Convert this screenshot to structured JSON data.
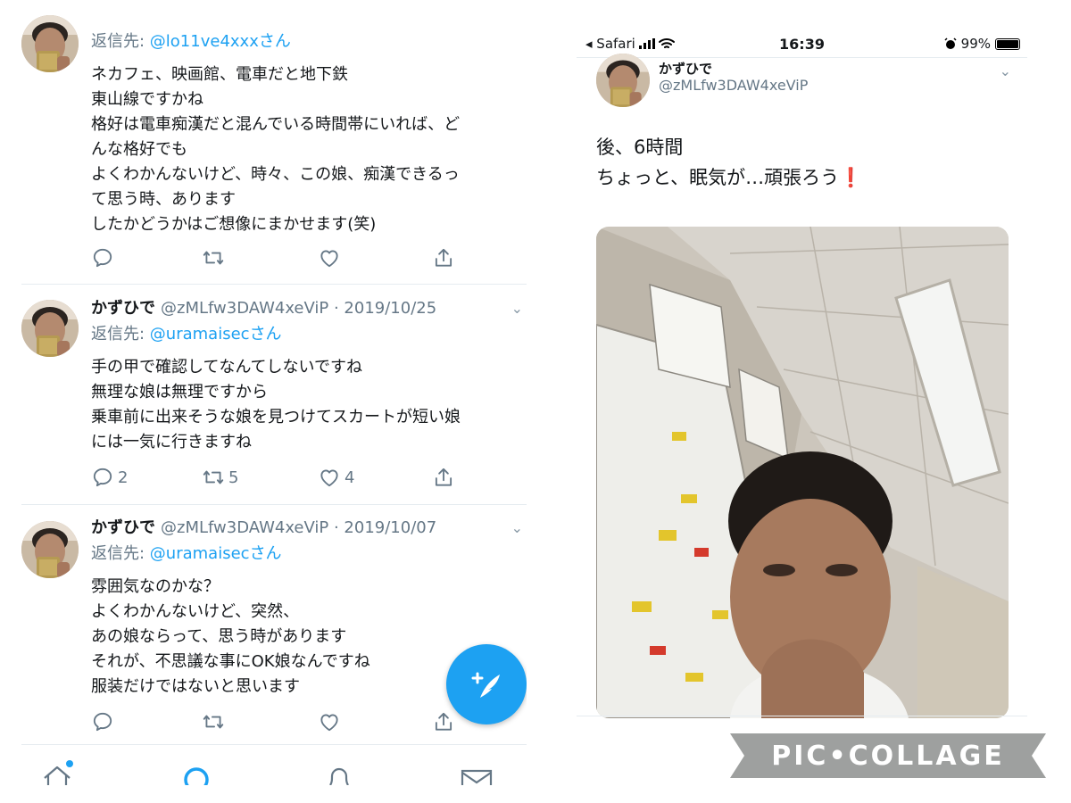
{
  "left": {
    "tweets": [
      {
        "reply_prefix": "返信先: ",
        "reply_to": "@lo11ve4xxx",
        "reply_suffix": "さん",
        "lines": [
          "ネカフェ、映画館、電車だと地下鉄",
          "東山線ですかね",
          "格好は電車痴漢だと混んでいる時間帯にいれば、ど",
          "んな格好でも",
          "よくわかんないけど、時々、この娘、痴漢できるっ",
          "て思う時、あります",
          "したかどうかはご想像にまかせます(笑)"
        ]
      },
      {
        "name": "かずひで",
        "handle": "@zMLfw3DAW4xeViP · 2019/10/25",
        "reply_prefix": "返信先: ",
        "reply_to": "@uramaisec",
        "reply_suffix": "さん",
        "lines": [
          "手の甲で確認してなんてしないですね",
          "無理な娘は無理ですから",
          "乗車前に出来そうな娘を見つけてスカートが短い娘",
          "には一気に行きますね"
        ],
        "reply_count": "2",
        "retweet_count": "5",
        "like_count": "4"
      },
      {
        "name": "かずひで",
        "handle": "@zMLfw3DAW4xeViP · 2019/10/07",
        "reply_prefix": "返信先: ",
        "reply_to": "@uramaisec",
        "reply_suffix": "さん",
        "lines": [
          "雰囲気なのかな？",
          "よくわかんないけど、突然、",
          "あの娘ならって、思う時があります",
          "それが、不思議な事にOK娘なんですね",
          "服装だけではないと思います"
        ]
      }
    ]
  },
  "right": {
    "status": {
      "back_label": "◂ Safari",
      "time": "16:39",
      "battery": "99%"
    },
    "tweet": {
      "name": "かずひで",
      "handle": "@zMLfw3DAW4xeViP",
      "line1": "後、6時間",
      "line2": "ちょっと、眠気が…頑張ろう",
      "emoji": "❗"
    }
  },
  "watermark": "PIC•COLLAGE",
  "colors": {
    "link": "#1da1f2",
    "muted": "#657786",
    "divider": "#e6ecf0",
    "exclaim": "#e0245e"
  },
  "icons": [
    "reply-icon",
    "retweet-icon",
    "like-icon",
    "share-icon",
    "compose-icon",
    "home-icon",
    "search-icon",
    "notifications-icon",
    "messages-icon",
    "wifi-icon",
    "signal-icon",
    "alarm-icon",
    "battery-icon",
    "chevron-down-icon"
  ]
}
